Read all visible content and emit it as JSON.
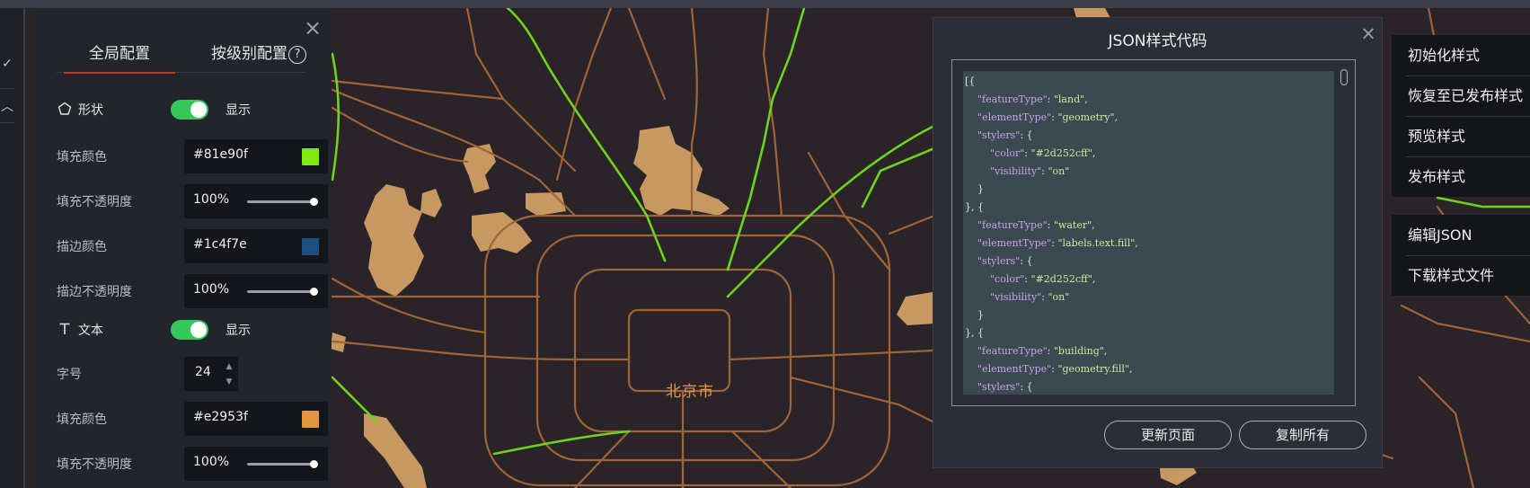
{
  "colors": {
    "map_bg": "#2a2328",
    "road": "#a0643a",
    "road_bright": "#c7773b",
    "highway_green": "#6fd21b",
    "land_patch": "#c89863",
    "accent_red": "#c0392b",
    "toggle_on": "#34c759"
  },
  "map": {
    "city_label": "北京市"
  },
  "panel": {
    "tabs": [
      {
        "label": "全局配置",
        "active": true
      },
      {
        "label": "按级别配置",
        "active": false
      }
    ],
    "help_icon_glyph": "?",
    "close_glyph": "×",
    "shape_section": {
      "icon": "pentagon-icon",
      "label": "形状",
      "toggle_on": true,
      "toggle_label": "显示"
    },
    "shape_props": {
      "fill_color": {
        "label": "填充颜色",
        "value": "#81e90f",
        "swatch": "#81e90f"
      },
      "fill_opacity": {
        "label": "填充不透明度",
        "value": "100%"
      },
      "stroke_color": {
        "label": "描边颜色",
        "value": "#1c4f7e",
        "swatch": "#1c4f7e"
      },
      "stroke_opacity": {
        "label": "描边不透明度",
        "value": "100%"
      }
    },
    "text_section": {
      "icon": "text-icon",
      "label": "文本",
      "toggle_on": true,
      "toggle_label": "显示"
    },
    "text_props": {
      "font_size": {
        "label": "字号",
        "value": "24"
      },
      "fill_color": {
        "label": "填充颜色",
        "value": "#e2953f",
        "swatch": "#e2953f"
      },
      "fill_opacity": {
        "label": "填充不透明度",
        "value": "100%"
      }
    }
  },
  "dialog": {
    "title": "JSON样式代码",
    "close_glyph": "×",
    "code_lines": [
      "[{",
      "    \"featureType\": \"land\",",
      "    \"elementType\": \"geometry\",",
      "    \"stylers\": {",
      "        \"color\": \"#2d252cff\",",
      "        \"visibility\": \"on\"",
      "    }",
      "}, {",
      "    \"featureType\": \"water\",",
      "    \"elementType\": \"labels.text.fill\",",
      "    \"stylers\": {",
      "        \"color\": \"#2d252cff\",",
      "        \"visibility\": \"on\"",
      "    }",
      "}, {",
      "    \"featureType\": \"building\",",
      "    \"elementType\": \"geometry.fill\",",
      "    \"stylers\": {"
    ],
    "buttons": {
      "update": "更新页面",
      "copy": "复制所有"
    }
  },
  "menu": {
    "group1": [
      "初始化样式",
      "恢复至已发布样式",
      "预览样式",
      "发布样式"
    ],
    "group2": [
      "编辑JSON",
      "下载样式文件"
    ]
  },
  "rail": {
    "check_glyph": "✓",
    "collapse_glyph": "︿"
  }
}
